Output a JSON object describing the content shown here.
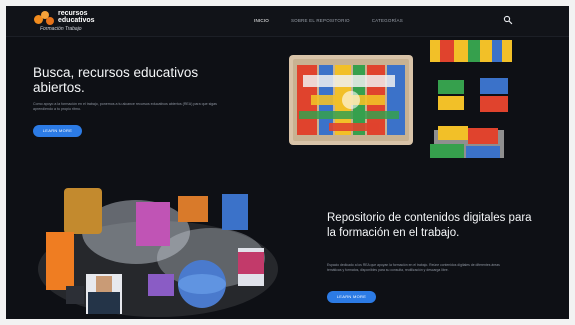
{
  "nav": {
    "logo_line1": "recursos",
    "logo_line2": "educativos",
    "logo_line3": "Formación  Trabajo",
    "items": [
      {
        "label": "INICIO",
        "active": true
      },
      {
        "label": "SOBRE EL REPOSITORIO",
        "active": false
      },
      {
        "label": "CATEGORÍAS",
        "active": false
      }
    ]
  },
  "hero": {
    "title": "Busca, recursos educativos abiertos.",
    "text": "Como apoyo a la formación en el trabajo, ponemos a tu alcance recursos educativos abiertos (REA) para que sigas aprendiendo a tu propio ritmo.",
    "button": "LEARN MORE"
  },
  "repo": {
    "title": "Repositorio de contenidos digitales para la formación en el trabajo.",
    "text": "Espacio dedicado a los REA que apoyan la formación en el trabajo. Reúne contenidos digitales de diferentes áreas temáticas y formatos, disponibles para su consulta, reutilización y descarga libre.",
    "button": "LEARN MORE"
  },
  "colors": {
    "background": "#0e1015",
    "accent": "#2c7be5",
    "logo_orange": "#f28c1e"
  },
  "icons": {
    "search": "search-icon",
    "logo": "logo-icon"
  }
}
